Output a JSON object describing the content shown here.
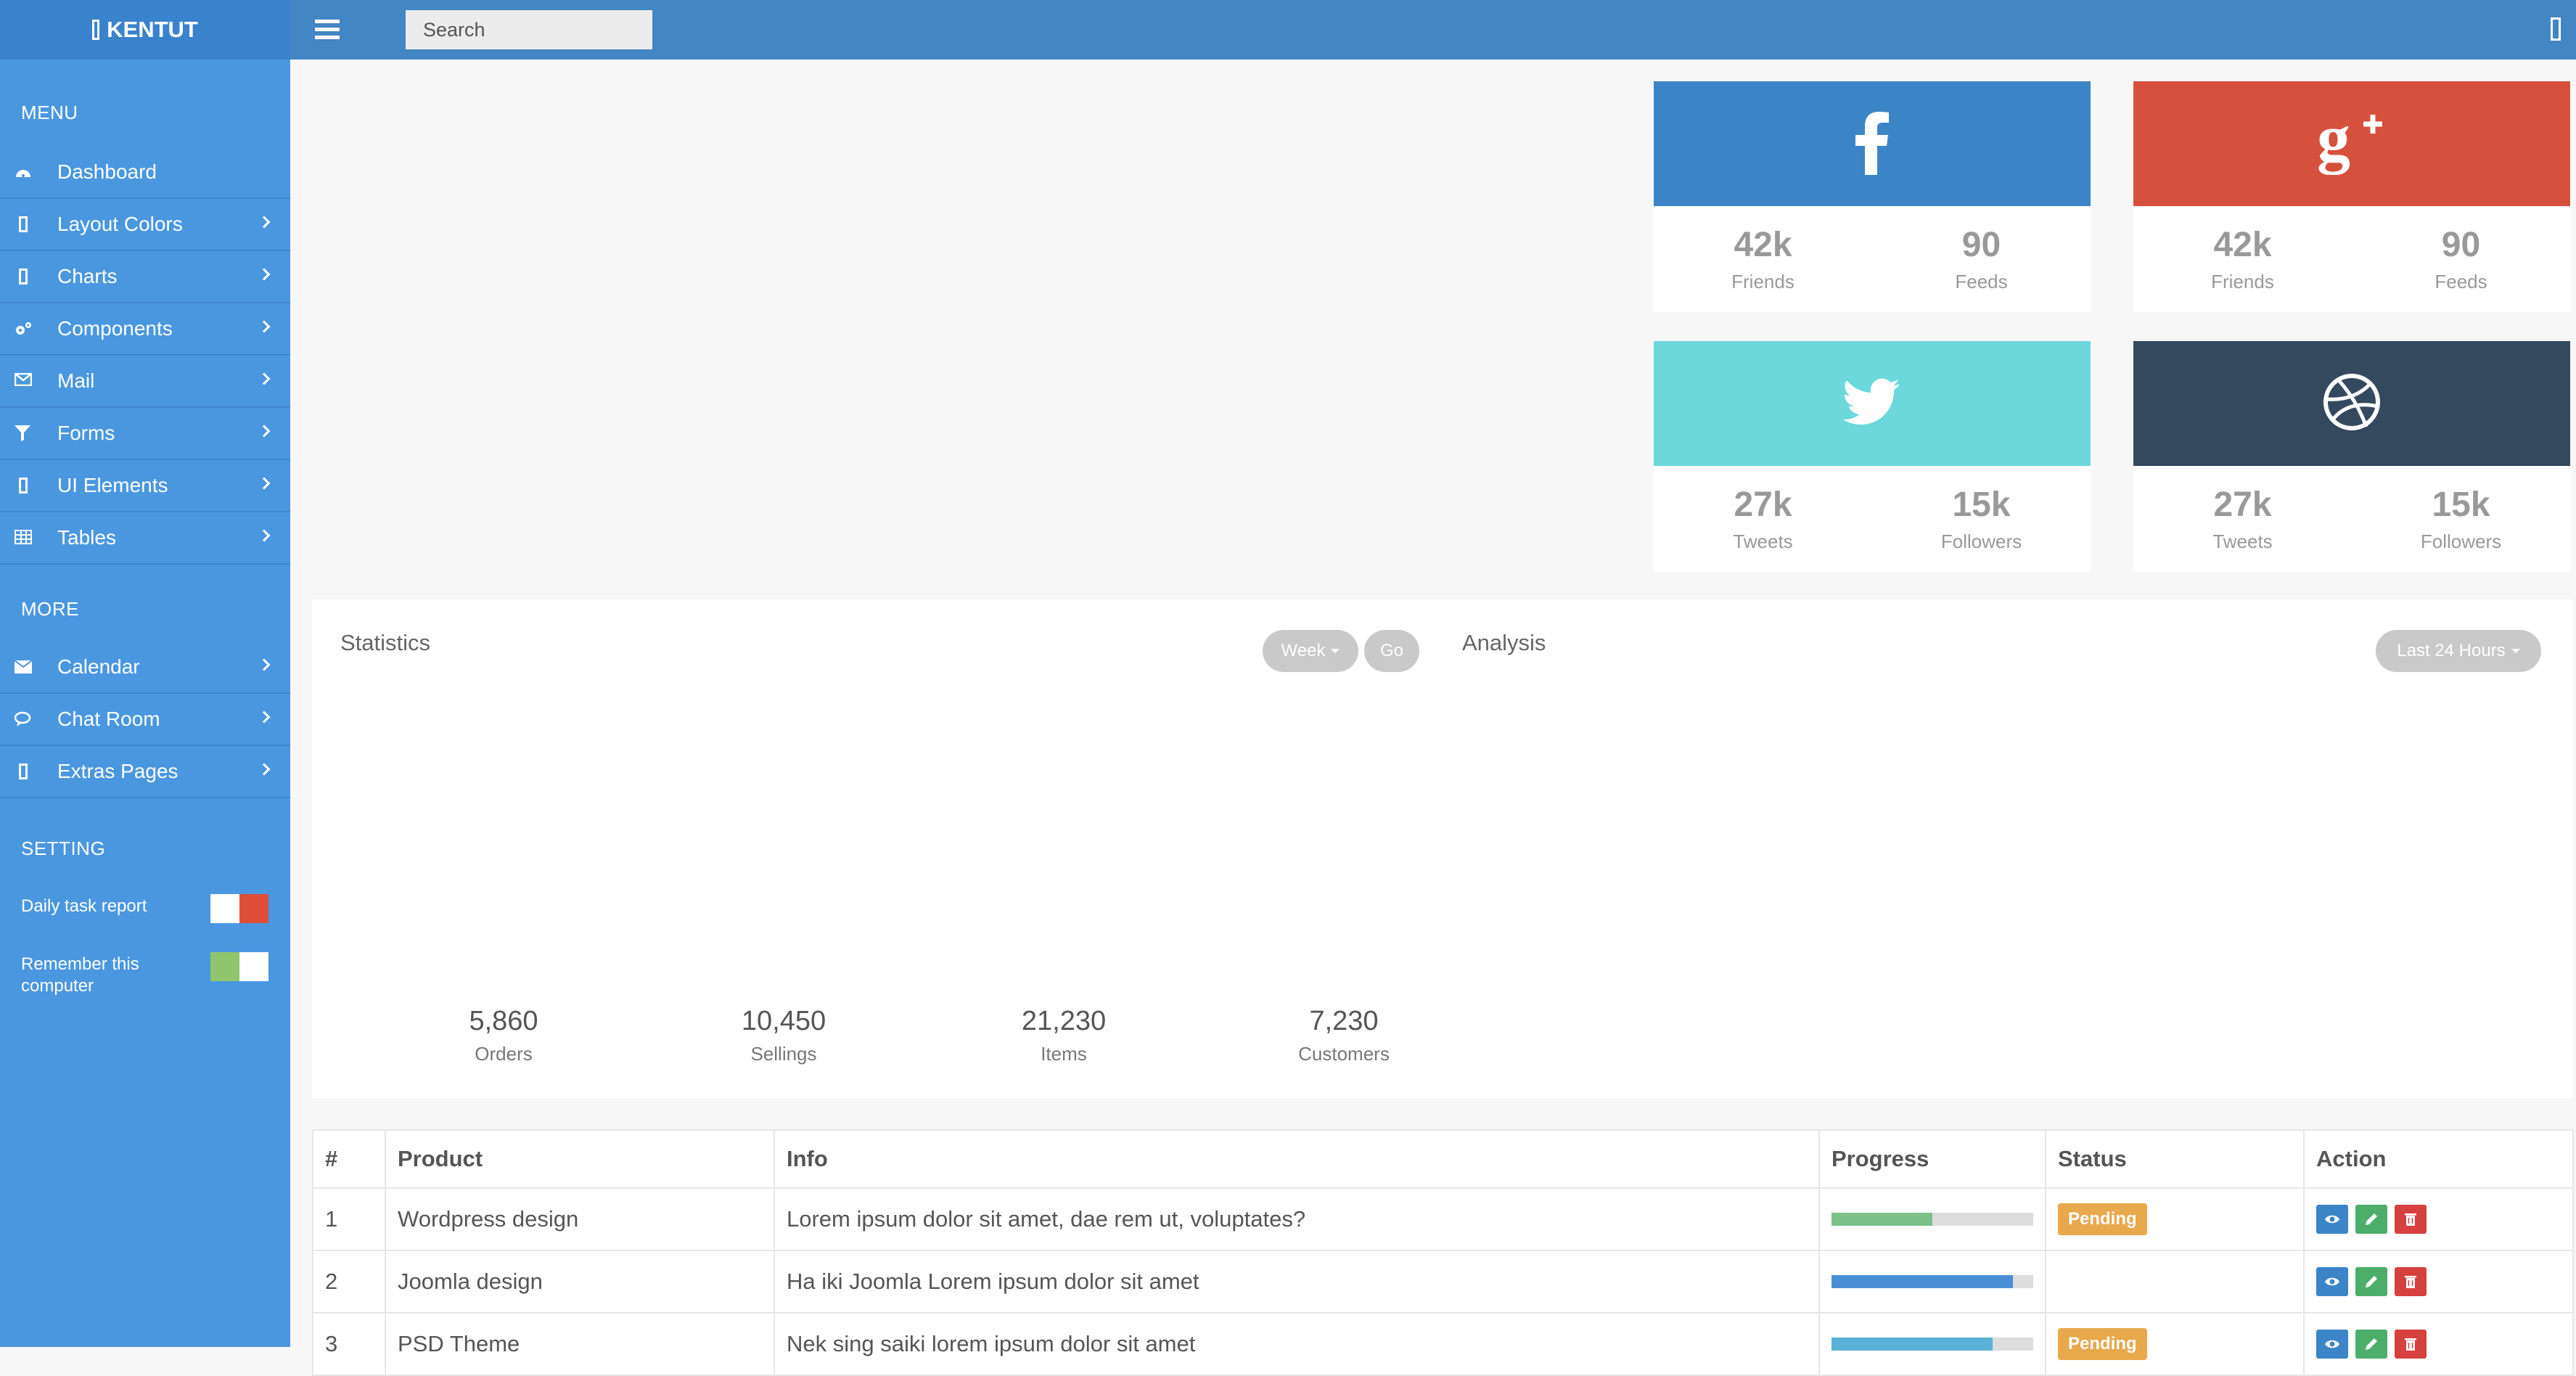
{
  "app": {
    "brand": "KENTUT",
    "search_placeholder": "Search"
  },
  "sidebar": {
    "menu_title": "MENU",
    "menu_items": [
      {
        "label": "Dashboard",
        "icon": "dashboard-icon",
        "has_arrow": false
      },
      {
        "label": "Layout Colors",
        "icon": "layout-icon",
        "has_arrow": true
      },
      {
        "label": "Charts",
        "icon": "charts-icon",
        "has_arrow": true
      },
      {
        "label": "Components",
        "icon": "cogs-icon",
        "has_arrow": true
      },
      {
        "label": "Mail",
        "icon": "envelope-icon",
        "has_arrow": true
      },
      {
        "label": "Forms",
        "icon": "filter-icon",
        "has_arrow": true
      },
      {
        "label": "UI Elements",
        "icon": "ui-icon",
        "has_arrow": true
      },
      {
        "label": "Tables",
        "icon": "table-icon",
        "has_arrow": true
      }
    ],
    "more_title": "MORE",
    "more_items": [
      {
        "label": "Calendar",
        "icon": "calendar-icon",
        "has_arrow": true
      },
      {
        "label": "Chat Room",
        "icon": "chat-icon",
        "has_arrow": true
      },
      {
        "label": "Extras Pages",
        "icon": "extras-icon",
        "has_arrow": true
      }
    ],
    "setting_title": "SETTING",
    "settings": [
      {
        "label": "Daily task report",
        "enabled": false
      },
      {
        "label": "Remember this computer",
        "enabled": true
      }
    ]
  },
  "social": [
    {
      "network": "facebook",
      "color": "#3b85c7",
      "stats": [
        {
          "value": "42k",
          "label": "Friends"
        },
        {
          "value": "90",
          "label": "Feeds"
        }
      ]
    },
    {
      "network": "google-plus",
      "color": "#d6503e",
      "stats": [
        {
          "value": "42k",
          "label": "Friends"
        },
        {
          "value": "90",
          "label": "Feeds"
        }
      ]
    },
    {
      "network": "twitter",
      "color": "#6cd8dc",
      "stats": [
        {
          "value": "27k",
          "label": "Tweets"
        },
        {
          "value": "15k",
          "label": "Followers"
        }
      ]
    },
    {
      "network": "dribbble",
      "color": "#34495e",
      "stats": [
        {
          "value": "27k",
          "label": "Tweets"
        },
        {
          "value": "15k",
          "label": "Followers"
        }
      ]
    }
  ],
  "statistics": {
    "title": "Statistics",
    "range_button": "Week",
    "go_button": "Go",
    "kpis": [
      {
        "value": "5,860",
        "label": "Orders"
      },
      {
        "value": "10,450",
        "label": "Sellings"
      },
      {
        "value": "21,230",
        "label": "Items"
      },
      {
        "value": "7,230",
        "label": "Customers"
      }
    ]
  },
  "analysis": {
    "title": "Analysis",
    "range_button": "Last 24 Hours"
  },
  "table": {
    "headers": [
      "#",
      "Product",
      "Info",
      "Progress",
      "Status",
      "Action"
    ],
    "rows": [
      {
        "num": "1",
        "product": "Wordpress design",
        "info": "Lorem ipsum dolor sit amet, dae rem ut, voluptates?",
        "progress": 0.5,
        "progress_color": "#7cc08a",
        "status": "Pending",
        "status_color": "#e8a84c"
      },
      {
        "num": "2",
        "product": "Joomla design",
        "info": "Ha iki Joomla Lorem ipsum dolor sit amet",
        "progress": 0.9,
        "progress_color": "#4a8fd6",
        "status": "",
        "status_color": ""
      },
      {
        "num": "3",
        "product": "PSD Theme",
        "info": "Nek sing saiki lorem ipsum dolor sit amet",
        "progress": 0.8,
        "progress_color": "#5ab0d6",
        "status": "Pending",
        "status_color": "#e8a84c"
      }
    ],
    "actions": [
      {
        "name": "view",
        "color": "#3b85c7"
      },
      {
        "name": "edit",
        "color": "#4cae6a"
      },
      {
        "name": "delete",
        "color": "#d6403e"
      }
    ]
  },
  "colors": {
    "topbar": "#4286c4",
    "sidebar": "#4a97e0",
    "toggle_on": "#8fc56c",
    "toggle_off": "#e04e3a"
  }
}
